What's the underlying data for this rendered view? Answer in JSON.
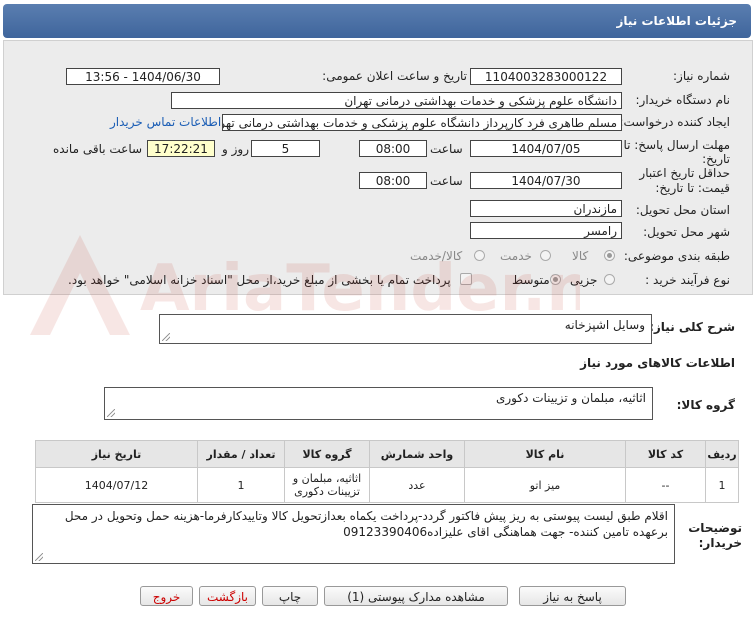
{
  "header": {
    "title": "جزئیات اطلاعات نیاز"
  },
  "form": {
    "need_number_label": "شماره نیاز:",
    "need_number": "1104003283000122",
    "announce_label": "تاریخ و ساعت اعلان عمومی:",
    "announce_value": "1404/06/30 - 13:56",
    "buyer_org_label": "نام دستگاه خریدار:",
    "buyer_org": "دانشگاه علوم پزشکی و خدمات بهداشتی درمانی تهران",
    "creator_label": "ایجاد کننده درخواست:",
    "creator": "مسلم طاهری فرد کارپرداز دانشگاه علوم پزشکی و خدمات بهداشتی درمانی تهر",
    "contact_link": "اطلاعات تماس خریدار",
    "deadline_label_1": "مهلت ارسال پاسخ: تا",
    "deadline_label_2": "تاریخ:",
    "deadline_date": "1404/07/05",
    "time_label": "ساعت",
    "deadline_time": "08:00",
    "days_value": "5",
    "days_label": "روز و",
    "remaining_time": "17:22:21",
    "remaining_label": "ساعت باقی مانده",
    "validity_label_1": "حداقل تاریخ اعتبار",
    "validity_label_2": "قیمت: تا تاریخ:",
    "validity_date": "1404/07/30",
    "validity_time_label": "ساعت",
    "validity_time": "08:00",
    "province_label": "استان محل تحویل:",
    "province": "مازندران",
    "city_label": "شهر محل تحویل:",
    "city": "رامسر",
    "category_label": "طبقه بندی موضوعی:",
    "category_options": [
      "کالا",
      "خدمت",
      "کالا/خدمت"
    ],
    "process_label": "نوع فرآیند خرید :",
    "process_options": [
      "جزیی",
      "متوسط"
    ],
    "treasury_note": "پرداخت تمام یا بخشی از مبلغ خرید،از محل \"اسناد خزانه اسلامی\" خواهد بود."
  },
  "summary": {
    "label": "شرح کلی نیاز:",
    "value": "وسایل اشپزخانه"
  },
  "goods": {
    "section_title": "اطلاعات کالاهای مورد نیاز",
    "group_label": "گروه کالا:",
    "group_value": "اثاثیه، مبلمان و تزیینات دکوری"
  },
  "table": {
    "headers": [
      "ردیف",
      "کد کالا",
      "نام کالا",
      "واحد شمارش",
      "گروه کالا",
      "تعداد / مقدار",
      "تاریخ نیاز"
    ],
    "rows": [
      [
        "1",
        "--",
        "میز اتو",
        "عدد",
        "اثاثیه، مبلمان و تزیینات دکوری",
        "1",
        "1404/07/12"
      ]
    ]
  },
  "notes": {
    "label_1": "توضیحات",
    "label_2": "خریدار:",
    "text": "اقلام طبق لیست پیوستی به ریز پیش فاکتور گردد-پرداخت یکماه بعدازتحویل کالا وتاییدکارفرما-هزینه حمل وتحویل در محل برعهده تامین کننده- جهت هماهنگی اقای علیزاده09123390406"
  },
  "buttons": {
    "reply": "پاسخ به نیاز",
    "attachments": "مشاهده مدارک پیوستی (1)",
    "print": "چاپ",
    "back": "بازگشت",
    "exit": "خروج"
  },
  "watermark": {
    "text": "AriaTender.net"
  },
  "colors": {
    "header": "#4a70a6",
    "link": "#1a5db5",
    "panel": "#ececec",
    "watermark": "#c0392b"
  }
}
